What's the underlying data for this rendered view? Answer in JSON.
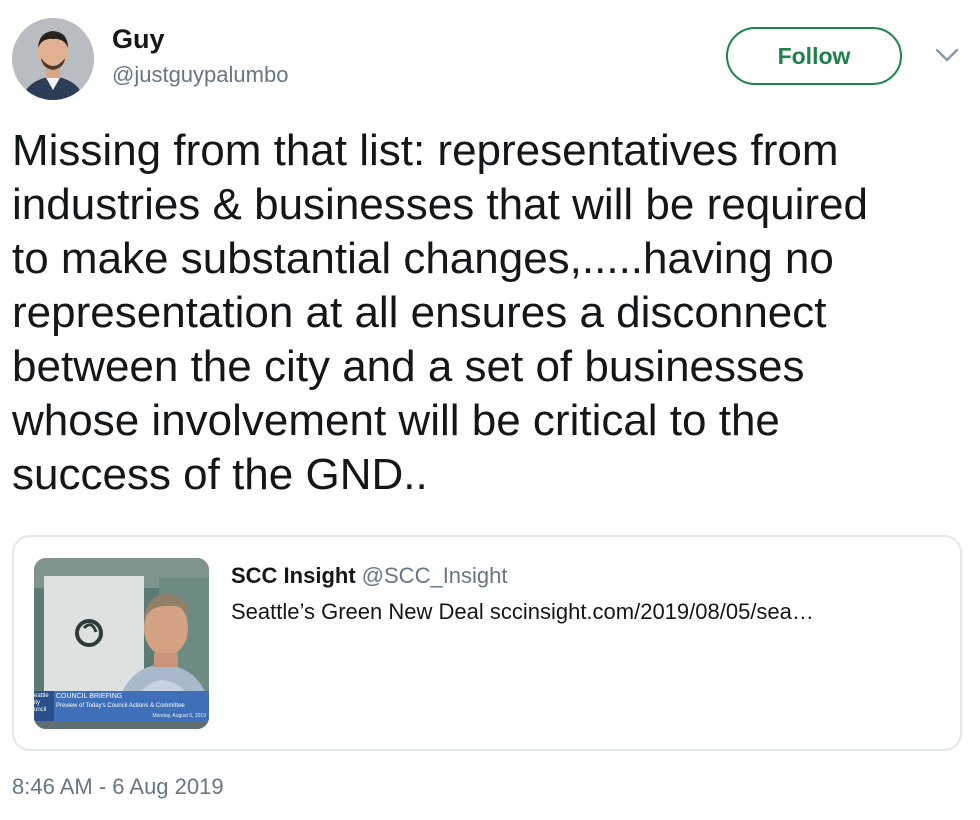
{
  "author": {
    "display_name": "Guy",
    "handle": "@justguypalumbo",
    "avatar_icon": "profile-photo"
  },
  "actions": {
    "follow_label": "Follow",
    "menu_icon": "chevron-down-icon"
  },
  "tweet": {
    "text": "Missing from that list: representatives from\nindustries & businesses that will be required\nto make substantial changes,.....having no\nrepresentation at all ensures a disconnect\nbetween the city and a set of businesses\nwhose involvement will be critical to the\nsuccess of the GND..",
    "timestamp": "8:46 AM - 6 Aug 2019"
  },
  "quoted_tweet": {
    "name": "SCC Insight",
    "handle": "@SCC_Insight",
    "text": "Seattle’s Green New Deal sccinsight.com/2019/08/05/sea…",
    "thumbnail": {
      "banner_title": "COUNCIL BRIEFING",
      "banner_subtitle": "Preview of Today's Council Actions & Committee",
      "banner_date": "Monday, August 5, 2019",
      "banner_left": "eattle\nity\nuncil"
    }
  },
  "colors": {
    "follow_green": "#1d8348",
    "secondary_text": "#657786",
    "border": "#e1e8ed"
  }
}
